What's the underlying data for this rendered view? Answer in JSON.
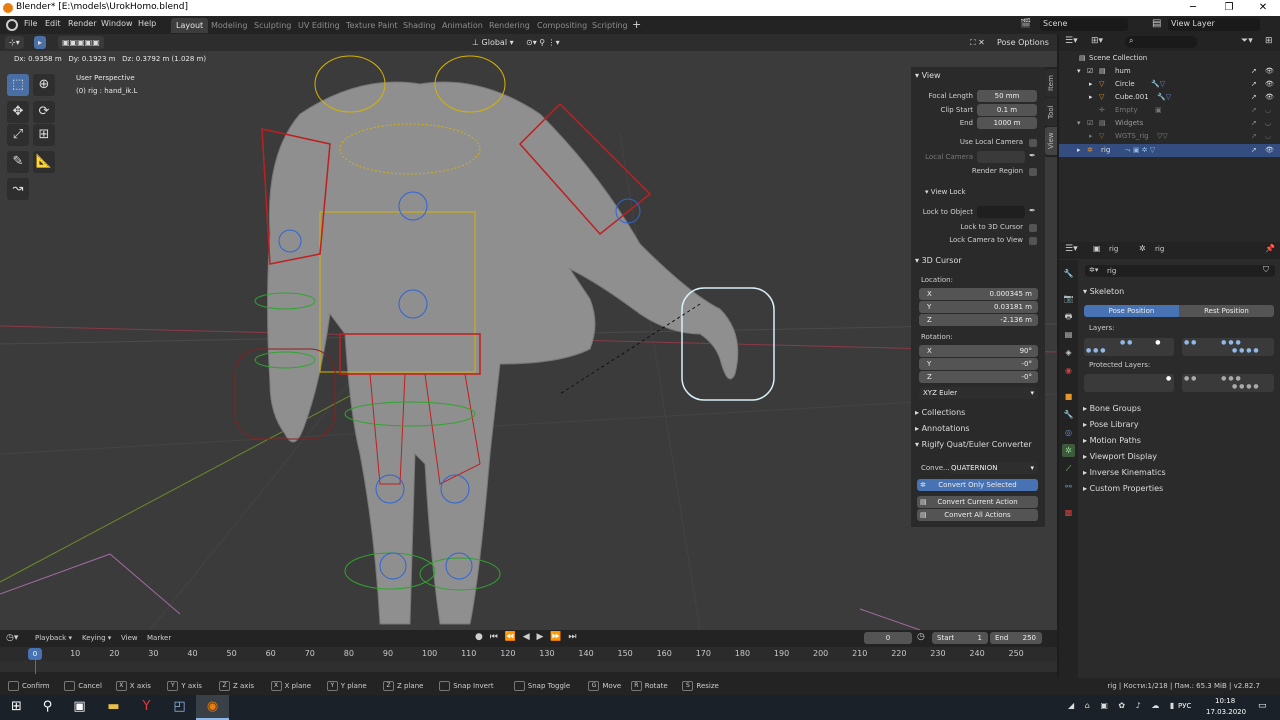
{
  "window": {
    "title": "Blender* [E:\\models\\UrokHomo.blend]",
    "minimize_icon": "─",
    "maximize_icon": "❐",
    "close_icon": "✕"
  },
  "menus": [
    "File",
    "Edit",
    "Render",
    "Window",
    "Help"
  ],
  "workspaces": [
    "Layout",
    "Modeling",
    "Sculpting",
    "UV Editing",
    "Texture Paint",
    "Shading",
    "Animation",
    "Rendering",
    "Compositing",
    "Scripting"
  ],
  "add_workspace": "+",
  "scene": {
    "name": "Scene",
    "view_layer": "View Layer"
  },
  "viewport": {
    "transform_orientation": "Global",
    "pose_options": "Pose Options",
    "delta_readout": "Dx: 0.9358 m   Dy: 0.1923 m   Dz: 0.3792 m (1.028 m)",
    "perspective": "User Perspective",
    "active_info": "(0) rig : hand_ik.L"
  },
  "npanel": {
    "tabs": [
      "Item",
      "Tool",
      "View"
    ],
    "view": {
      "title": "View",
      "focal_label": "Focal Length",
      "focal_value": "50 mm",
      "clip_start_label": "Clip Start",
      "clip_start_value": "0.1 m",
      "end_label": "End",
      "end_value": "1000 m",
      "use_local_camera": "Use Local Camera",
      "local_camera": "Local Camera",
      "render_region": "Render Region"
    },
    "view_lock": {
      "title": "View Lock",
      "lock_to_object": "Lock to Object",
      "lock_3d_cursor": "Lock to 3D Cursor",
      "lock_camera": "Lock Camera to View"
    },
    "cursor": {
      "title": "3D Cursor",
      "location_label": "Location:",
      "loc": [
        {
          "axis": "X",
          "value": "0.000345 m"
        },
        {
          "axis": "Y",
          "value": "0.03181 m"
        },
        {
          "axis": "Z",
          "value": "-2.136 m"
        }
      ],
      "rotation_label": "Rotation:",
      "rot": [
        {
          "axis": "X",
          "value": "90°"
        },
        {
          "axis": "Y",
          "value": "-0°"
        },
        {
          "axis": "Z",
          "value": "-0°"
        }
      ],
      "mode": "XYZ Euler"
    },
    "collections": "Collections",
    "annotations": "Annotations",
    "rigify": {
      "title": "Rigify Quat/Euler Converter",
      "convert_label": "Conve...",
      "convert_value": "QUATERNION",
      "only_selected": "Convert Only Selected",
      "current_action": "Convert Current Action",
      "all_actions": "Convert All Actions"
    }
  },
  "outliner": {
    "search_placeholder": "",
    "rows": [
      {
        "label": "Scene Collection"
      },
      {
        "label": "hum"
      },
      {
        "label": "Circle"
      },
      {
        "label": "Cube.001"
      },
      {
        "label": "Empty"
      },
      {
        "label": "Widgets"
      },
      {
        "label": "WGTS_rig"
      },
      {
        "label": "rig"
      }
    ]
  },
  "properties": {
    "breadcrumb_object": "rig",
    "breadcrumb_armature": "rig",
    "datablock_name": "rig",
    "skeleton": "Skeleton",
    "pose_position": "Pose Position",
    "rest_position": "Rest Position",
    "layers": "Layers:",
    "protected_layers": "Protected Layers:",
    "panels": [
      "Bone Groups",
      "Pose Library",
      "Motion Paths",
      "Viewport Display",
      "Inverse Kinematics",
      "Custom Properties"
    ]
  },
  "timeline": {
    "menus": [
      "Playback",
      "Keying",
      "View",
      "Marker"
    ],
    "current_frame": "0",
    "start_label": "Start",
    "start_value": "1",
    "end_label": "End",
    "end_value": "250",
    "ticks": [
      "0",
      "10",
      "20",
      "30",
      "40",
      "50",
      "60",
      "70",
      "80",
      "90",
      "100",
      "110",
      "120",
      "130",
      "140",
      "150",
      "160",
      "170",
      "180",
      "190",
      "200",
      "210",
      "220",
      "230",
      "240",
      "250"
    ]
  },
  "status": {
    "hints": [
      {
        "key": "",
        "label": "Confirm"
      },
      {
        "key": "",
        "label": "Cancel"
      },
      {
        "key": "X",
        "label": "X axis"
      },
      {
        "key": "Y",
        "label": "Y axis"
      },
      {
        "key": "Z",
        "label": "Z axis"
      },
      {
        "key": "X",
        "label": "X plane"
      },
      {
        "key": "Y",
        "label": "Y plane"
      },
      {
        "key": "Z",
        "label": "Z plane"
      },
      {
        "key": "",
        "label": "Snap Invert"
      },
      {
        "key": "",
        "label": "Snap Toggle"
      },
      {
        "key": "G",
        "label": "Move"
      },
      {
        "key": "R",
        "label": "Rotate"
      },
      {
        "key": "S",
        "label": "Resize"
      }
    ],
    "right": "rig | Кости:1/218 | Пам.: 65.3 MiB | v2.82.7"
  },
  "taskbar": {
    "time": "10:18",
    "date": "17.03.2020",
    "lang": "РУС"
  },
  "colors": {
    "accent": "#4772b3",
    "selection": "#334d80",
    "viewport_bg": "#3b3b3b"
  }
}
